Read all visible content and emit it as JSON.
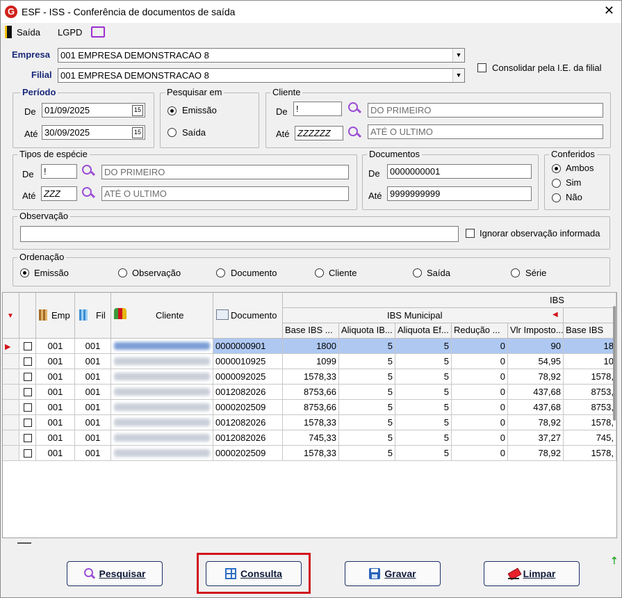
{
  "window": {
    "logo": "G",
    "title": "ESF - ISS - Conferência de documentos de saída",
    "close": "✕"
  },
  "toolbar": {
    "saida_label": "Saída",
    "lgpd_label": "LGPD"
  },
  "empresa": {
    "label": "Empresa",
    "value": "001 EMPRESA DEMONSTRACAO 8"
  },
  "filial": {
    "label": "Filial",
    "value": "001 EMPRESA DEMONSTRACAO 8"
  },
  "consolidar": {
    "label": "Consolidar pela I.E. da filial",
    "checked": false
  },
  "periodo": {
    "legend": "Período",
    "de_label": "De",
    "de_value": "01/09/2025",
    "ate_label": "Até",
    "ate_value": "30/09/2025",
    "cal_icon": "15"
  },
  "pesquisar_em": {
    "legend": "Pesquisar em",
    "options": [
      "Emissão",
      "Saída"
    ],
    "selected": "Emissão"
  },
  "cliente": {
    "legend": "Cliente",
    "de_label": "De",
    "de_code": "!",
    "de_name": "DO PRIMEIRO",
    "ate_label": "Até",
    "ate_code": "ZZZZZZ",
    "ate_name": "ATÉ O ULTIMO"
  },
  "tipos_especie": {
    "legend": "Tipos de espécie",
    "de_label": "De",
    "de_code": "!",
    "de_name": "DO PRIMEIRO",
    "ate_label": "Até",
    "ate_code": "ZZZ",
    "ate_name": "ATÉ O ULTIMO"
  },
  "documentos": {
    "legend": "Documentos",
    "de_label": "De",
    "de_value": "0000000001",
    "ate_label": "Até",
    "ate_value": "9999999999"
  },
  "conferidos": {
    "legend": "Conferidos",
    "options": [
      "Ambos",
      "Sim",
      "Não"
    ],
    "selected": "Ambos"
  },
  "observacao": {
    "legend": "Observação",
    "value": "",
    "ignorar_label": "Ignorar observação informada"
  },
  "ordenacao": {
    "legend": "Ordenação",
    "options": [
      "Emissão",
      "Observação",
      "Documento",
      "Cliente",
      "Saída",
      "Série"
    ],
    "selected": "Emissão"
  },
  "grid": {
    "group_ibs": "IBS",
    "group_ibs_municipal": "IBS Municipal",
    "col_emp": "Emp",
    "col_fil": "Fil",
    "col_cliente": "Cliente",
    "col_documento": "Documento",
    "sub_cols": [
      "Base IBS ...",
      "Aliquota IB...",
      "Aliquota Ef...",
      "Redução ...",
      "Vlr Imposto...",
      "Base IBS"
    ],
    "rows": [
      {
        "emp": "001",
        "fil": "001",
        "doc": "0000000901",
        "base": "1800",
        "aliq": "5",
        "aliq_ef": "5",
        "red": "0",
        "vlr": "90",
        "base2": "18"
      },
      {
        "emp": "001",
        "fil": "001",
        "doc": "0000010925",
        "base": "1099",
        "aliq": "5",
        "aliq_ef": "5",
        "red": "0",
        "vlr": "54,95",
        "base2": "10"
      },
      {
        "emp": "001",
        "fil": "001",
        "doc": "0000092025",
        "base": "1578,33",
        "aliq": "5",
        "aliq_ef": "5",
        "red": "0",
        "vlr": "78,92",
        "base2": "1578,"
      },
      {
        "emp": "001",
        "fil": "001",
        "doc": "0012082026",
        "base": "8753,66",
        "aliq": "5",
        "aliq_ef": "5",
        "red": "0",
        "vlr": "437,68",
        "base2": "8753,"
      },
      {
        "emp": "001",
        "fil": "001",
        "doc": "0000202509",
        "base": "8753,66",
        "aliq": "5",
        "aliq_ef": "5",
        "red": "0",
        "vlr": "437,68",
        "base2": "8753,"
      },
      {
        "emp": "001",
        "fil": "001",
        "doc": "0012082026",
        "base": "1578,33",
        "aliq": "5",
        "aliq_ef": "5",
        "red": "0",
        "vlr": "78,92",
        "base2": "1578,"
      },
      {
        "emp": "001",
        "fil": "001",
        "doc": "0012082026",
        "base": "745,33",
        "aliq": "5",
        "aliq_ef": "5",
        "red": "0",
        "vlr": "37,27",
        "base2": "745,"
      },
      {
        "emp": "001",
        "fil": "001",
        "doc": "0000202509",
        "base": "1578,33",
        "aliq": "5",
        "aliq_ef": "5",
        "red": "0",
        "vlr": "78,92",
        "base2": "1578,"
      }
    ]
  },
  "buttons": {
    "pesquisar": "Pesquisar",
    "consulta": "Consulta",
    "gravar": "Gravar",
    "limpar": "Limpar"
  },
  "colors": {
    "accent_bold": "#1a2a7a",
    "highlight": "#d0141c",
    "selected_row": "#aec8f2",
    "search_icon": "#9b4fd6"
  }
}
